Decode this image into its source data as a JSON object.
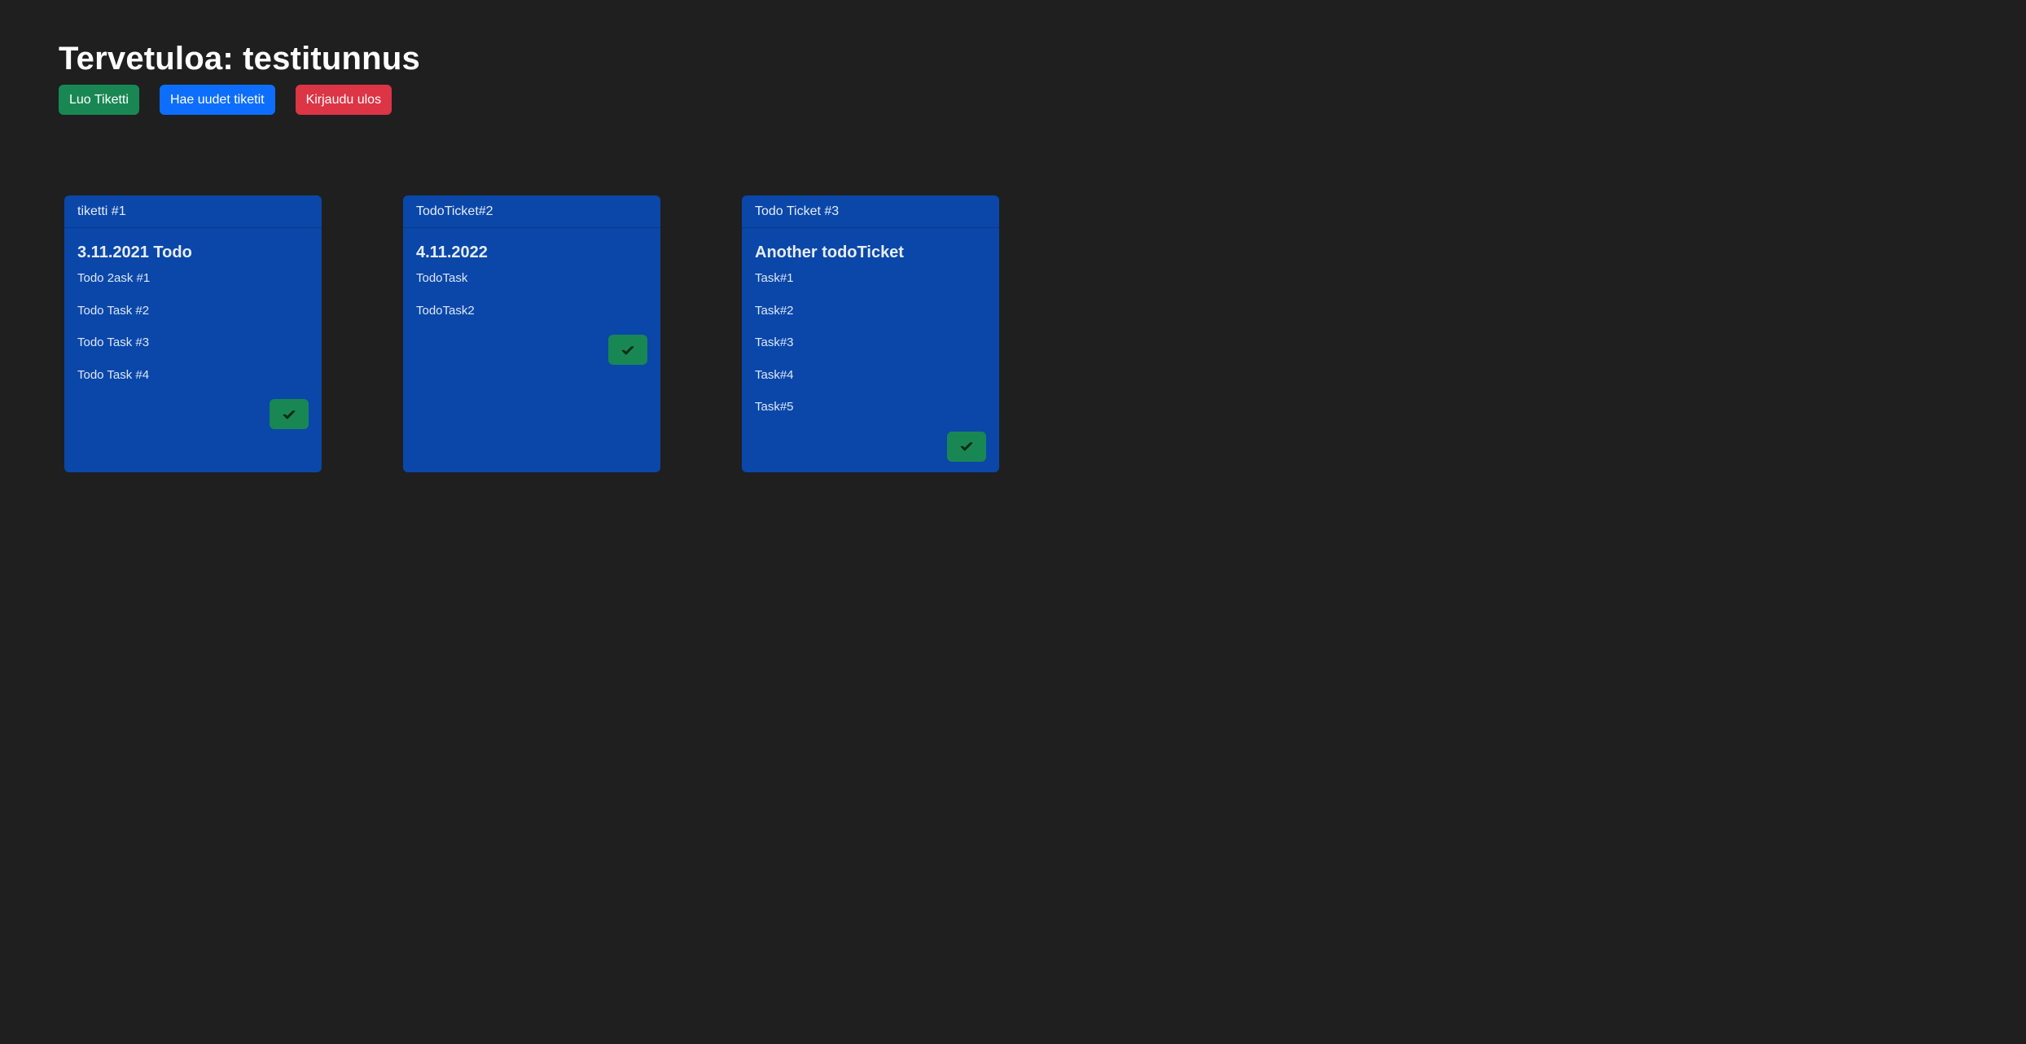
{
  "header": {
    "title": "Tervetuloa: testitunnus",
    "buttons": {
      "create": "Luo Tiketti",
      "fetch": "Hae uudet tiketit",
      "logout": "Kirjaudu ulos"
    }
  },
  "colors": {
    "background": "#1f1f1f",
    "card": "#0a47a9",
    "success": "#198754",
    "primary": "#0d6efd",
    "danger": "#dc3545"
  },
  "tickets": [
    {
      "header": "tiketti #1",
      "title": "3.11.2021 Todo",
      "tasks": [
        "Todo 2ask #1",
        "Todo Task #2",
        "Todo Task #3",
        "Todo Task #4"
      ],
      "done_icon": "check-icon"
    },
    {
      "header": "TodoTicket#2",
      "title": "4.11.2022",
      "tasks": [
        "TodoTask",
        "TodoTask2"
      ],
      "done_icon": "check-icon"
    },
    {
      "header": "Todo Ticket #3",
      "title": "Another todoTicket",
      "tasks": [
        "Task#1",
        "Task#2",
        "Task#3",
        "Task#4",
        "Task#5"
      ],
      "done_icon": "check-icon"
    }
  ]
}
